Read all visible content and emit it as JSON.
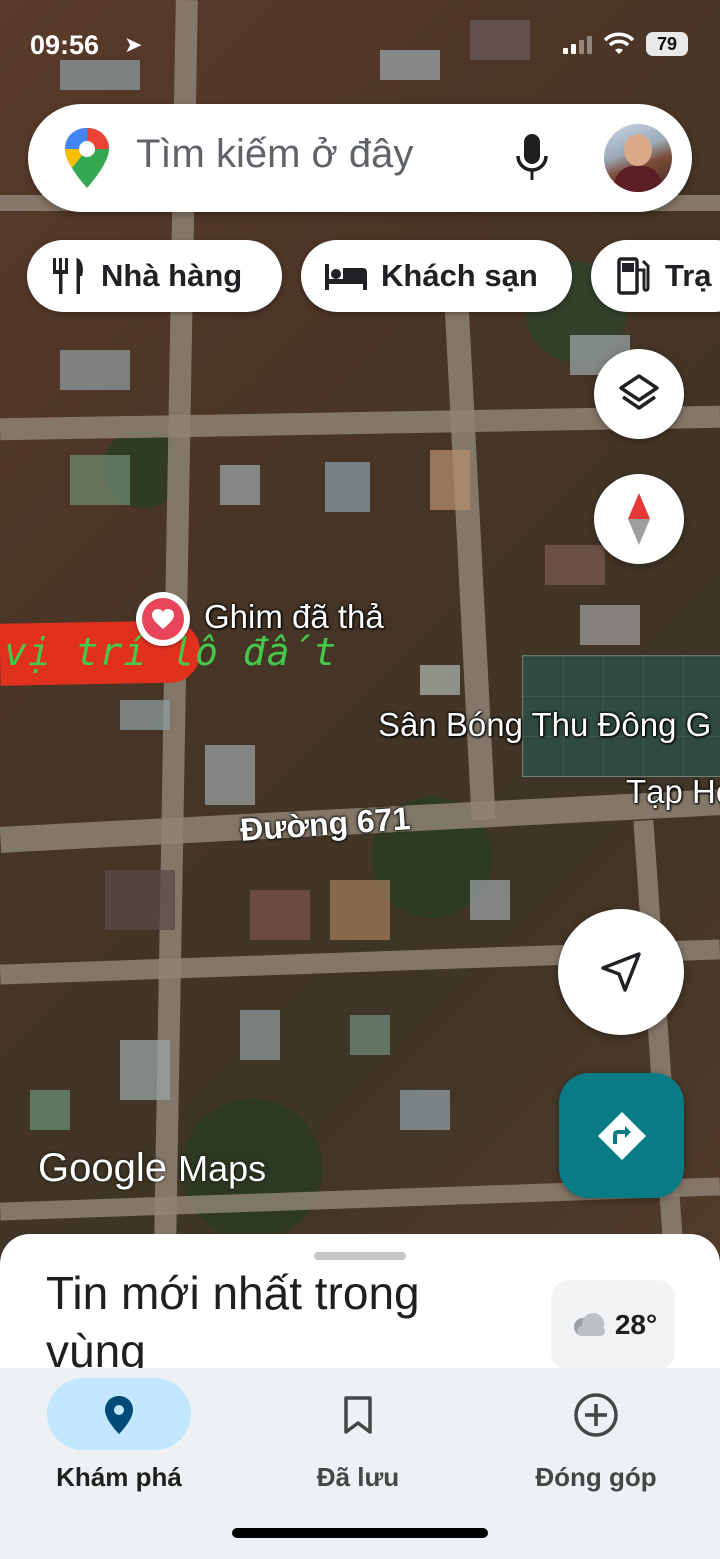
{
  "status_bar": {
    "time": "09:56",
    "battery": "79"
  },
  "search": {
    "placeholder": "Tìm kiếm ở đây"
  },
  "chips": [
    {
      "label": "Nhà hàng",
      "icon": "restaurant-icon"
    },
    {
      "label": "Khách sạn",
      "icon": "hotel-icon"
    },
    {
      "label": "Trạ",
      "icon": "gas-station-icon"
    }
  ],
  "map": {
    "pin_label": "Ghim đã thả",
    "annotation": "vị trí lô đất",
    "places": [
      "Sân Bóng Thu Đông G",
      "Tạp Ho"
    ],
    "road_label": "Đường 671",
    "watermark_google": "Google",
    "watermark_maps": "Maps"
  },
  "sheet": {
    "title": "Tin mới nhất trong vùng",
    "temperature": "28°"
  },
  "bottom_nav": [
    {
      "label": "Khám phá",
      "icon": "explore-pin-icon",
      "active": true
    },
    {
      "label": "Đã lưu",
      "icon": "bookmark-icon",
      "active": false
    },
    {
      "label": "Đóng góp",
      "icon": "add-circle-icon",
      "active": false
    }
  ],
  "colors": {
    "accent": "#087b85",
    "active_pill": "#c2e7ff",
    "pin": "#e8455a"
  }
}
